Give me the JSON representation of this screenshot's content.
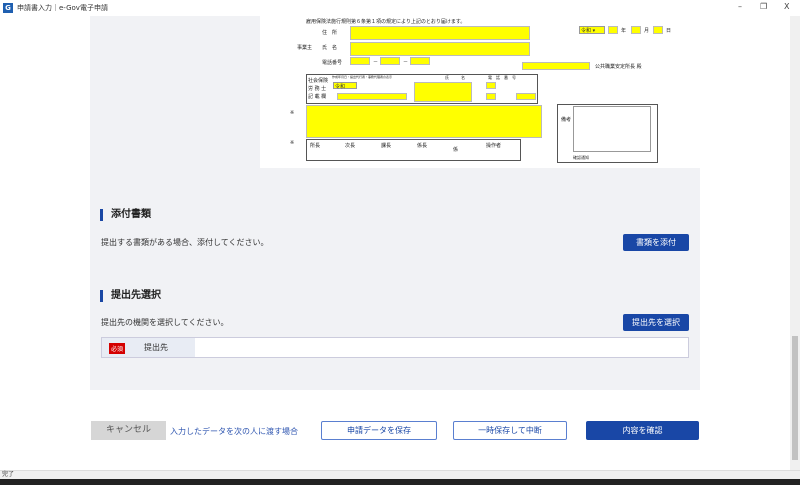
{
  "window": {
    "title": "申請書入力｜e-Gov電子申請",
    "icon": "e-gov-logo-icon",
    "min": "–",
    "restore": "❐",
    "close": "X"
  },
  "form": {
    "declaration": "雇用保険法施行規則第６条第１項の規定により上記のとおり届けます。",
    "address_label": "住　所",
    "employer_label": "事業主",
    "name_label": "氏　名",
    "phone_label": "電話番号",
    "era": "令和",
    "year": "年",
    "month": "月",
    "day": "日",
    "dash": "－",
    "office_suffix": "公共職業安定所長 殿",
    "sr_label": [
      "社会保険",
      "労 務 士",
      "記 載 欄"
    ],
    "sr_header": "作成年月日・提出代行者・事務代理者の表示",
    "sr_name": "氏　　　名",
    "sr_phone": "電　話　番　号",
    "mark": "※",
    "stamps": [
      "所長",
      "次長",
      "課長",
      "係長",
      "係",
      "操作者"
    ],
    "remarks": "備考",
    "confirm_notice": "確認通知"
  },
  "attachments": {
    "heading": "添付書類",
    "description": "提出する書類がある場合、添付してください。",
    "button": "書類を添付"
  },
  "destination": {
    "heading": "提出先選択",
    "description": "提出先の機関を選択してください。",
    "button": "提出先を選択",
    "required_badge": "必須",
    "field_label": "提出先",
    "field_value": ""
  },
  "footer": {
    "cancel": "キャンセル",
    "handover_link": "入力したデータを次の人に渡す場合",
    "save": "申請データを保存",
    "pause": "一時保存して中断",
    "confirm": "内容を確認"
  },
  "status": {
    "text": "完了"
  },
  "colors": {
    "primary": "#1947a6",
    "required": "#d40000",
    "field": "#ffff00"
  }
}
